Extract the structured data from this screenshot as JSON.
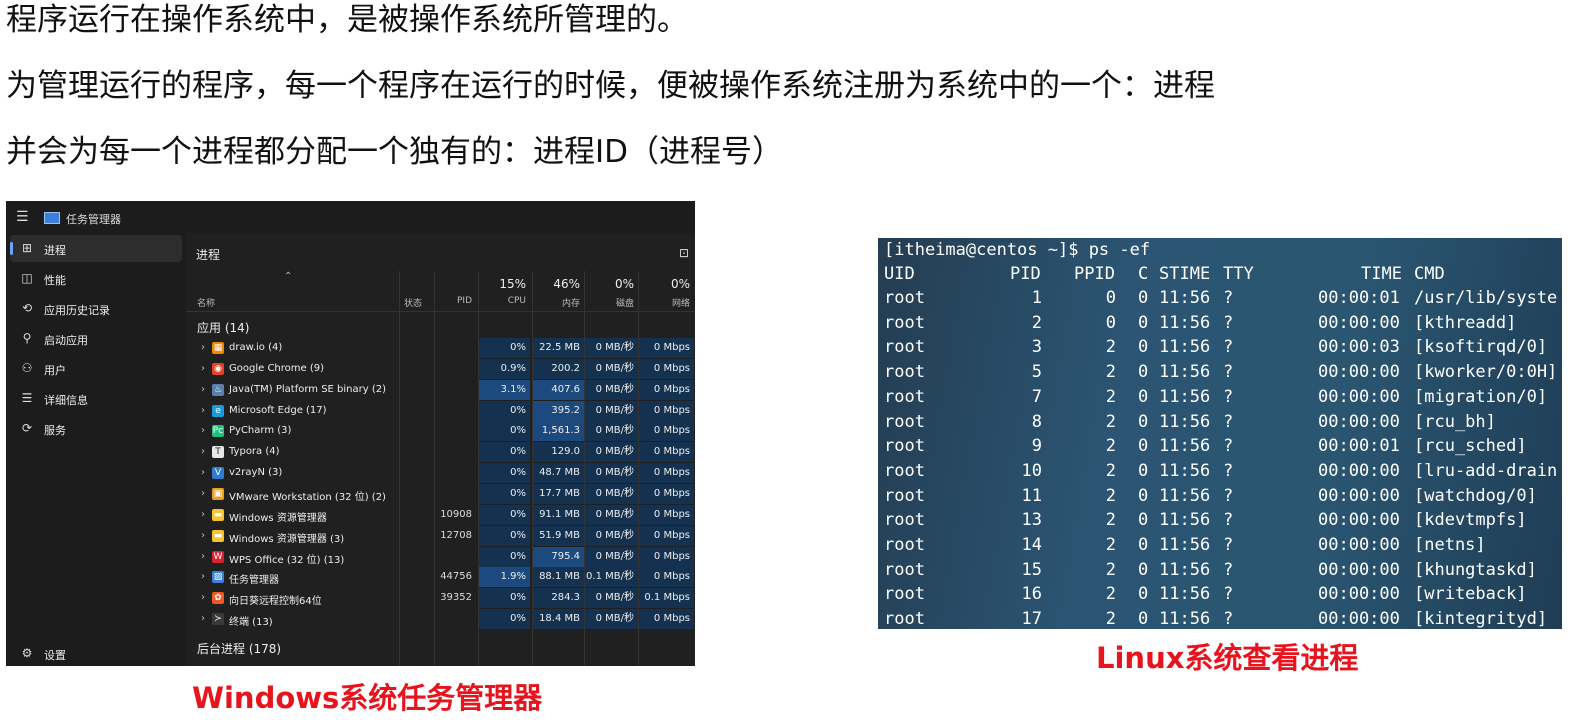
{
  "paragraphs": [
    "程序运行在操作系统中，是被操作系统所管理的。",
    "为管理运行的程序，每一个程序在运行的时候，便被操作系统注册为系统中的一个：进程",
    "并会为每一个进程都分配一个独有的：进程ID（进程号）"
  ],
  "task_manager": {
    "title": "任务管理器",
    "nav": [
      {
        "label": "进程",
        "icon": "grid-icon",
        "glyph": "⊞",
        "active": true
      },
      {
        "label": "性能",
        "icon": "performance-icon",
        "glyph": "◫",
        "active": false
      },
      {
        "label": "应用历史记录",
        "icon": "history-icon",
        "glyph": "⟲",
        "active": false
      },
      {
        "label": "启动应用",
        "icon": "startup-icon",
        "glyph": "⚲",
        "active": false
      },
      {
        "label": "用户",
        "icon": "users-icon",
        "glyph": "⚇",
        "active": false
      },
      {
        "label": "详细信息",
        "icon": "details-list-icon",
        "glyph": "☰",
        "active": false
      },
      {
        "label": "服务",
        "icon": "services-icon",
        "glyph": "⟳",
        "active": false
      }
    ],
    "settings_label": "设置",
    "heading": "进程",
    "columns": {
      "name": "名称",
      "status": "状态",
      "pid": "PID",
      "cpu": "CPU",
      "memory": "内存",
      "disk": "磁盘",
      "network": "网络",
      "cpu_pct": "15%",
      "memory_pct": "46%",
      "disk_pct": "0%",
      "network_pct": "0%"
    },
    "group_apps": "应用 (14)",
    "group_background": "后台进程 (178)",
    "rows": [
      {
        "name": "draw.io (4)",
        "pid": "",
        "cpu": "0%",
        "memory": "22.5 MB",
        "disk": "0 MB/秒",
        "network": "0 Mbps",
        "icon_color": "#f08705",
        "glyph": "▦",
        "cpu_hi": false,
        "mem_hi": false
      },
      {
        "name": "Google Chrome (9)",
        "pid": "",
        "cpu": "0.9%",
        "memory": "200.2 MB",
        "disk": "0 MB/秒",
        "network": "0 Mbps",
        "icon_color": "#e0452b",
        "glyph": "◉",
        "cpu_hi": false,
        "mem_hi": false
      },
      {
        "name": "Java(TM) Platform SE binary (2)",
        "pid": "",
        "cpu": "3.1%",
        "memory": "407.6 MB",
        "disk": "0 MB/秒",
        "network": "0 Mbps",
        "icon_color": "#5a7fa8",
        "glyph": "♨",
        "cpu_hi": true,
        "mem_hi": true
      },
      {
        "name": "Microsoft Edge (17)",
        "pid": "",
        "cpu": "0%",
        "memory": "395.2 MB",
        "disk": "0 MB/秒",
        "network": "0 Mbps",
        "icon_color": "#1a9be0",
        "glyph": "e",
        "cpu_hi": false,
        "mem_hi": true
      },
      {
        "name": "PyCharm (3)",
        "pid": "",
        "cpu": "0%",
        "memory": "1,561.3 ...",
        "disk": "0 MB/秒",
        "network": "0 Mbps",
        "icon_color": "#21c17a",
        "glyph": "Pc",
        "cpu_hi": false,
        "mem_hi": true
      },
      {
        "name": "Typora (4)",
        "pid": "",
        "cpu": "0%",
        "memory": "129.0 MB",
        "disk": "0 MB/秒",
        "network": "0 Mbps",
        "icon_color": "#e8e8e8",
        "glyph": "T",
        "cpu_hi": false,
        "mem_hi": false
      },
      {
        "name": "v2rayN (3)",
        "pid": "",
        "cpu": "0%",
        "memory": "48.7 MB",
        "disk": "0 MB/秒",
        "network": "0 Mbps",
        "icon_color": "#2f7dd1",
        "glyph": "V",
        "cpu_hi": false,
        "mem_hi": false
      },
      {
        "name": "VMware Workstation (32 位) (2)",
        "pid": "",
        "cpu": "0%",
        "memory": "17.7 MB",
        "disk": "0 MB/秒",
        "network": "0 Mbps",
        "icon_color": "#f0a01a",
        "glyph": "▣",
        "cpu_hi": false,
        "mem_hi": false
      },
      {
        "name": "Windows 资源管理器",
        "pid": "10908",
        "cpu": "0%",
        "memory": "91.1 MB",
        "disk": "0 MB/秒",
        "network": "0 Mbps",
        "icon_color": "#f5c430",
        "glyph": "▬",
        "cpu_hi": false,
        "mem_hi": false
      },
      {
        "name": "Windows 资源管理器 (3)",
        "pid": "12708",
        "cpu": "0%",
        "memory": "51.9 MB",
        "disk": "0 MB/秒",
        "network": "0 Mbps",
        "icon_color": "#f5c430",
        "glyph": "▬",
        "cpu_hi": false,
        "mem_hi": false
      },
      {
        "name": "WPS Office (32 位) (13)",
        "pid": "",
        "cpu": "0%",
        "memory": "795.4 MB",
        "disk": "0 MB/秒",
        "network": "0 Mbps",
        "icon_color": "#d8242f",
        "glyph": "W",
        "cpu_hi": false,
        "mem_hi": true
      },
      {
        "name": "任务管理器",
        "pid": "44756",
        "cpu": "1.9%",
        "memory": "88.1 MB",
        "disk": "0.1 MB/秒",
        "network": "0 Mbps",
        "icon_color": "#3b7fd9",
        "glyph": "▨",
        "cpu_hi": true,
        "mem_hi": false
      },
      {
        "name": "向日葵远程控制64位",
        "pid": "39352",
        "cpu": "0%",
        "memory": "284.3 MB",
        "disk": "0 MB/秒",
        "network": "0.1 Mbps",
        "icon_color": "#f05a22",
        "glyph": "✿",
        "cpu_hi": false,
        "mem_hi": false
      },
      {
        "name": "终端 (13)",
        "pid": "",
        "cpu": "0%",
        "memory": "18.4 MB",
        "disk": "0 MB/秒",
        "network": "0 Mbps",
        "icon_color": "#3a3a3a",
        "glyph": "≻",
        "cpu_hi": false,
        "mem_hi": false
      }
    ]
  },
  "terminal": {
    "prompt": "[itheima@centos ~]$ ps -ef",
    "header": {
      "uid": "UID",
      "pid": "PID",
      "ppid": "PPID",
      "c": "C",
      "stime": "STIME",
      "tty": "TTY",
      "time": "TIME",
      "cmd": "CMD"
    },
    "rows": [
      {
        "uid": "root",
        "pid": "1",
        "ppid": "0",
        "c": "0",
        "stime": "11:56",
        "tty": "?",
        "time": "00:00:01",
        "cmd": "/usr/lib/syste"
      },
      {
        "uid": "root",
        "pid": "2",
        "ppid": "0",
        "c": "0",
        "stime": "11:56",
        "tty": "?",
        "time": "00:00:00",
        "cmd": "[kthreadd]"
      },
      {
        "uid": "root",
        "pid": "3",
        "ppid": "2",
        "c": "0",
        "stime": "11:56",
        "tty": "?",
        "time": "00:00:03",
        "cmd": "[ksoftirqd/0]"
      },
      {
        "uid": "root",
        "pid": "5",
        "ppid": "2",
        "c": "0",
        "stime": "11:56",
        "tty": "?",
        "time": "00:00:00",
        "cmd": "[kworker/0:0H]"
      },
      {
        "uid": "root",
        "pid": "7",
        "ppid": "2",
        "c": "0",
        "stime": "11:56",
        "tty": "?",
        "time": "00:00:00",
        "cmd": "[migration/0]"
      },
      {
        "uid": "root",
        "pid": "8",
        "ppid": "2",
        "c": "0",
        "stime": "11:56",
        "tty": "?",
        "time": "00:00:00",
        "cmd": "[rcu_bh]"
      },
      {
        "uid": "root",
        "pid": "9",
        "ppid": "2",
        "c": "0",
        "stime": "11:56",
        "tty": "?",
        "time": "00:00:01",
        "cmd": "[rcu_sched]"
      },
      {
        "uid": "root",
        "pid": "10",
        "ppid": "2",
        "c": "0",
        "stime": "11:56",
        "tty": "?",
        "time": "00:00:00",
        "cmd": "[lru-add-drain"
      },
      {
        "uid": "root",
        "pid": "11",
        "ppid": "2",
        "c": "0",
        "stime": "11:56",
        "tty": "?",
        "time": "00:00:00",
        "cmd": "[watchdog/0]"
      },
      {
        "uid": "root",
        "pid": "13",
        "ppid": "2",
        "c": "0",
        "stime": "11:56",
        "tty": "?",
        "time": "00:00:00",
        "cmd": "[kdevtmpfs]"
      },
      {
        "uid": "root",
        "pid": "14",
        "ppid": "2",
        "c": "0",
        "stime": "11:56",
        "tty": "?",
        "time": "00:00:00",
        "cmd": "[netns]"
      },
      {
        "uid": "root",
        "pid": "15",
        "ppid": "2",
        "c": "0",
        "stime": "11:56",
        "tty": "?",
        "time": "00:00:00",
        "cmd": "[khungtaskd]"
      },
      {
        "uid": "root",
        "pid": "16",
        "ppid": "2",
        "c": "0",
        "stime": "11:56",
        "tty": "?",
        "time": "00:00:00",
        "cmd": "[writeback]"
      },
      {
        "uid": "root",
        "pid": "17",
        "ppid": "2",
        "c": "0",
        "stime": "11:56",
        "tty": "?",
        "time": "00:00:00",
        "cmd": "[kintegrityd]"
      }
    ]
  },
  "captions": {
    "windows": "Windows系统任务管理器",
    "linux": "Linux系统查看进程"
  },
  "colors": {
    "caption": "#e8141d",
    "highlight": "#1d4a7e",
    "cell": "#14324f"
  }
}
